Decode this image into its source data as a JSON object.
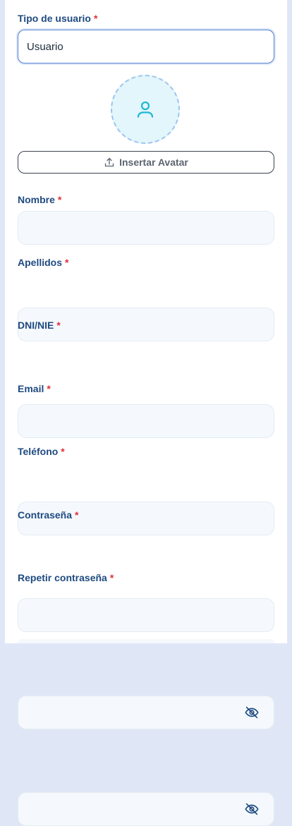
{
  "form": {
    "user_type": {
      "label": "Tipo de usuario",
      "required_mark": "*",
      "value": "Usuario"
    },
    "avatar_button_label": "Insertar Avatar",
    "fields": [
      {
        "label": "Nombre",
        "required_mark": "*",
        "value": ""
      },
      {
        "label": "Apellidos",
        "required_mark": "*",
        "value": ""
      },
      {
        "label": "DNI/NIE",
        "required_mark": "*",
        "value": ""
      },
      {
        "label": "Email",
        "required_mark": "*",
        "value": ""
      },
      {
        "label": "Teléfono",
        "required_mark": "*",
        "value": ""
      },
      {
        "label": "Contraseña",
        "required_mark": "*",
        "value": ""
      },
      {
        "label": "Repetir contraseña",
        "required_mark": "*",
        "value": ""
      }
    ]
  },
  "icons": {
    "avatar": "user-icon",
    "upload": "upload-icon",
    "password_toggle": "eye-off-icon"
  },
  "colors": {
    "label": "#1f4a80",
    "required": "#e02f3a",
    "avatar_accent": "#1fb8d3",
    "input_bg": "#f5f9fd"
  }
}
